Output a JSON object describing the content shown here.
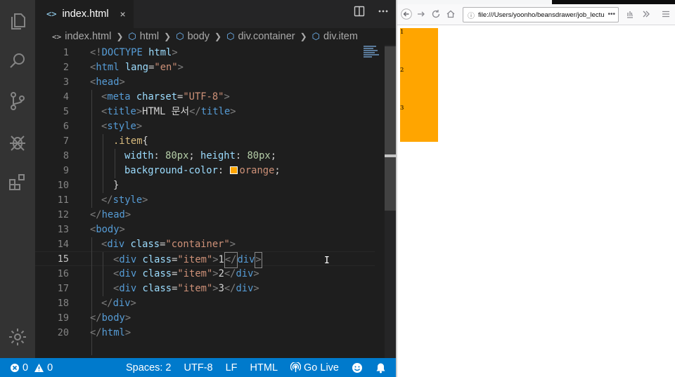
{
  "editor": {
    "tab": {
      "code_glyph": "<>",
      "title": "index.html",
      "close_glyph": "×"
    },
    "tab_actions": [
      "split-editor",
      "more-actions"
    ],
    "breadcrumb": [
      "index.html",
      "html",
      "body",
      "div.container",
      "div.item"
    ],
    "active_line": 15,
    "line_numbers": [
      "1",
      "2",
      "3",
      "4",
      "5",
      "6",
      "7",
      "8",
      "9",
      "10",
      "11",
      "12",
      "13",
      "14",
      "15",
      "16",
      "17",
      "18",
      "19",
      "20"
    ],
    "lines": {
      "l1": [
        "<!",
        "DOCTYPE",
        " ",
        "html",
        ">"
      ],
      "l2": [
        "<",
        "html",
        " ",
        "lang",
        "=",
        "\"en\"",
        ">"
      ],
      "l3": [
        "<",
        "head",
        ">"
      ],
      "l4": [
        "<",
        "meta",
        " ",
        "charset",
        "=",
        "\"UTF-8\"",
        ">"
      ],
      "l5": [
        "<",
        "title",
        ">",
        "HTML 문서",
        "</",
        "title",
        ">"
      ],
      "l6": [
        "<",
        "style",
        ">"
      ],
      "l7": [
        ".item",
        "{"
      ],
      "l8": [
        "width",
        ": ",
        "80px",
        "; ",
        "height",
        ": ",
        "80px",
        ";"
      ],
      "l9": [
        "background-color",
        ": ",
        "orange",
        ";"
      ],
      "l10": [
        "}"
      ],
      "l11": [
        "</",
        "style",
        ">"
      ],
      "l12": [
        "</",
        "head",
        ">"
      ],
      "l13": [
        "<",
        "body",
        ">"
      ],
      "l14": [
        "<",
        "div",
        " ",
        "class",
        "=",
        "\"container\"",
        ">"
      ],
      "l15": [
        "<",
        "div",
        " ",
        "class",
        "=",
        "\"item\"",
        ">",
        "1",
        "</",
        "div",
        ">"
      ],
      "l16": [
        "<",
        "div",
        " ",
        "class",
        "=",
        "\"item\"",
        ">",
        "2",
        "</",
        "div",
        ">"
      ],
      "l17": [
        "<",
        "div",
        " ",
        "class",
        "=",
        "\"item\"",
        ">",
        "3",
        "</",
        "div",
        ">"
      ],
      "l18": [
        "</",
        "div",
        ">"
      ],
      "l19": [
        "</",
        "body",
        ">"
      ],
      "l20": [
        "</",
        "html",
        ">"
      ]
    },
    "swatch_color": "#ffa500"
  },
  "status": {
    "errors": "0",
    "warnings": "0",
    "spaces": "Spaces: 2",
    "encoding": "UTF-8",
    "eol": "LF",
    "language": "HTML",
    "go_live": "Go Live",
    "bar_color": "#007acc"
  },
  "browser": {
    "url": "file:///Users/yoonho/beansdrawer/job_lectu",
    "url_more": "•••",
    "items": [
      "1",
      "2",
      "3"
    ],
    "item_color": "#ffa500"
  }
}
